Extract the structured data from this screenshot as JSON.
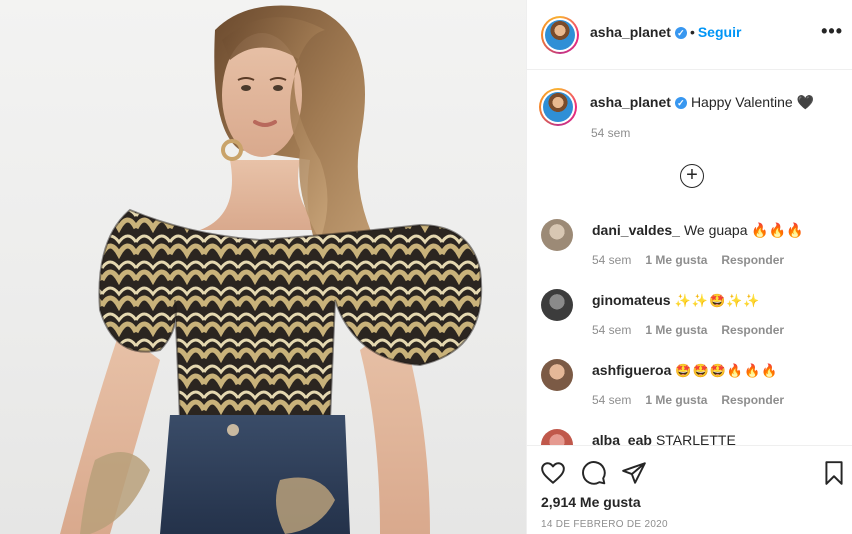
{
  "post": {
    "username": "asha_planet",
    "verified_mark": "✓",
    "separator": "•",
    "follow_label": "Seguir",
    "more_label": "•••",
    "caption": {
      "username": "asha_planet",
      "text": "Happy Valentine 🖤",
      "time": "54 sem"
    },
    "load_more_label": "+",
    "comments": [
      {
        "username": "dani_valdes_",
        "text": "We guapa 🔥🔥🔥",
        "time": "54 sem",
        "likes": "1 Me gusta",
        "reply": "Responder"
      },
      {
        "username": "ginomateus",
        "text": "✨✨🤩✨✨",
        "time": "54 sem",
        "likes": "1 Me gusta",
        "reply": "Responder"
      },
      {
        "username": "ashfigueroa",
        "text": "🤩🤩🤩🔥🔥🔥",
        "time": "54 sem",
        "likes": "1 Me gusta",
        "reply": "Responder"
      },
      {
        "username": "alba_eab",
        "text": "STARLETTE",
        "time": "",
        "likes": "",
        "reply": ""
      }
    ],
    "likes_count": "2,914 Me gusta",
    "date": "14 DE FEBRERO DE 2020"
  },
  "icons": {
    "like": "heart-icon",
    "comment": "comment-icon",
    "share": "paper-plane-icon",
    "save": "bookmark-icon",
    "more": "more-options-icon"
  },
  "colors": {
    "accent": "#0095f6",
    "verified": "#3897f0",
    "muted": "#8e8e8e",
    "text": "#262626"
  }
}
